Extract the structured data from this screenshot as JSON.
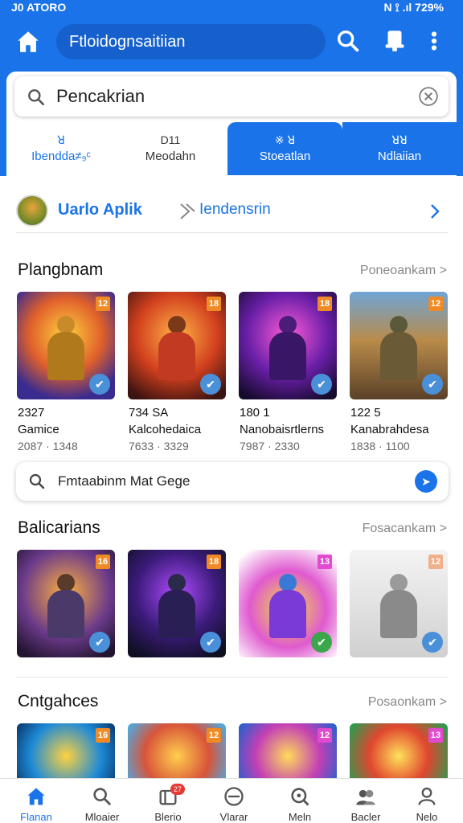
{
  "status": {
    "time": "J0 ATORO",
    "right": "N ⟟ .ıl 729%"
  },
  "appbar": {
    "title": "Ftloidognsaitiian"
  },
  "search": {
    "query": "Pencakrian"
  },
  "tabs": [
    {
      "icon": "ꓤ",
      "label": "Ibendda≠₉ᶜ"
    },
    {
      "icon": "D11",
      "label": "Meodahn"
    },
    {
      "icon": "※ ꓤ",
      "label": "Stoeatlan"
    },
    {
      "icon": "ꓤꓤ",
      "label": "Ndlaiian"
    }
  ],
  "recommend": {
    "title": "Uarlo Aplik",
    "subtitle": "Iendensrin"
  },
  "sections": [
    {
      "title": "Plangbnam",
      "more": "Poneoankam >",
      "cards": [
        {
          "badge": "12",
          "line1": "2327",
          "line2": "Gamice",
          "line3": "2087 · 1348"
        },
        {
          "badge": "18",
          "line1": "734 SA",
          "line2": "Kalcohedaica",
          "line3": "7633 · 3329"
        },
        {
          "badge": "18",
          "line1": "180 1",
          "line2": "Nanobaisrtlerns",
          "line3": "7987 · 2330"
        },
        {
          "badge": "12",
          "line1": "122 5",
          "line2": "Kanabrahdesa",
          "line3": "1838 · 1100"
        }
      ]
    },
    {
      "title": "Balicarians",
      "more": "Fosacankam >",
      "cards": [
        {
          "badge": "16"
        },
        {
          "badge": "18"
        },
        {
          "badge": "13"
        },
        {
          "badge": "12"
        }
      ]
    },
    {
      "title": "Cntgahces",
      "more": "Posaonkam >",
      "cards": [
        {
          "badge": "16"
        },
        {
          "badge": "12"
        },
        {
          "badge": "12"
        },
        {
          "badge": "13"
        }
      ]
    }
  ],
  "promo": {
    "text": "Fmtaabinm Mat Gege"
  },
  "nav": [
    {
      "label": "Flanan"
    },
    {
      "label": "Mloaier"
    },
    {
      "label": "Blerio",
      "badge": "27"
    },
    {
      "label": "Vlarar"
    },
    {
      "label": "Meln"
    },
    {
      "label": "Bacler"
    },
    {
      "label": "Nelo"
    }
  ],
  "colors": {
    "primary": "#1a73e8",
    "badge": "#f08a24",
    "check": "#4a90d9"
  }
}
